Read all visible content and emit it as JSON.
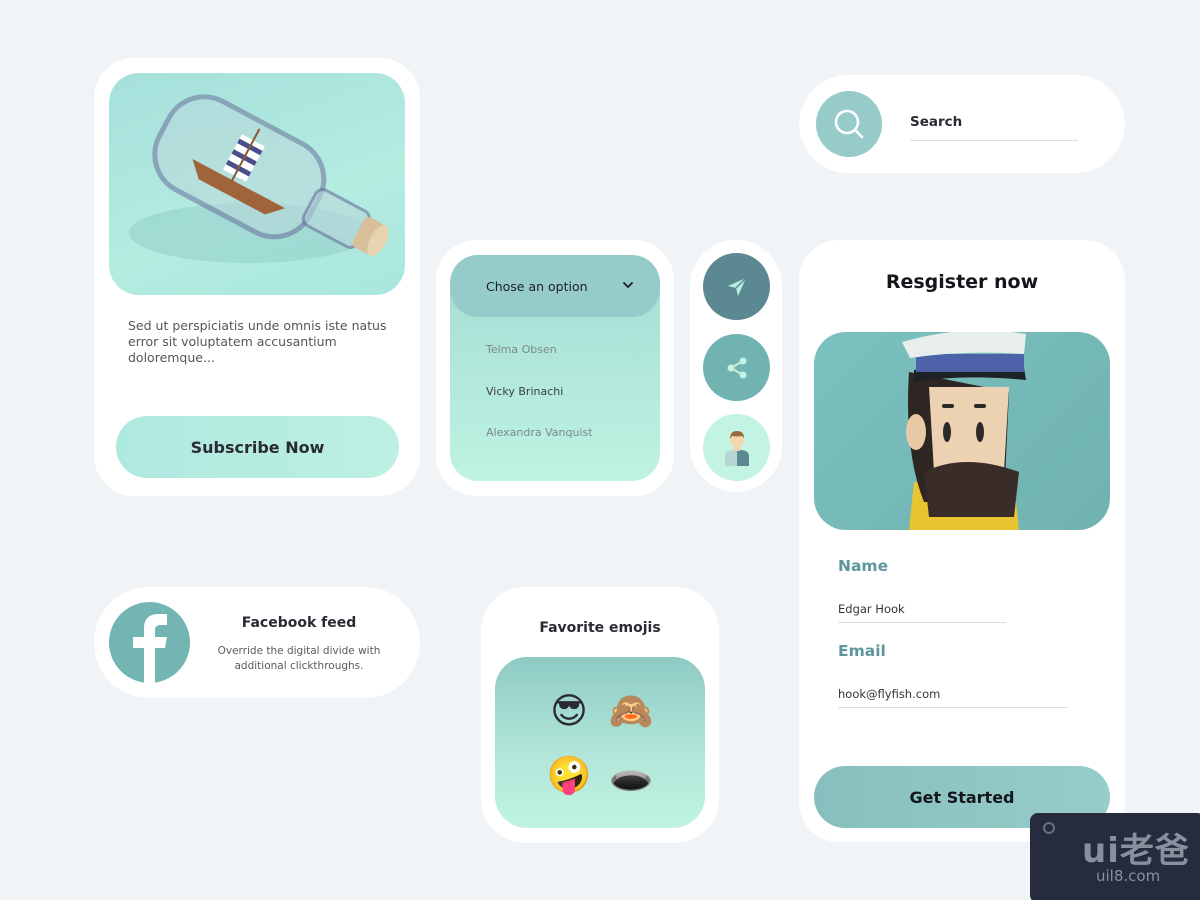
{
  "bottle_card": {
    "image_alt": "Ship in a bottle illustration",
    "description": "Sed ut perspiciatis unde omnis iste natus error sit voluptatem accusantium doloremque...",
    "subscribe_label": "Subscribe Now"
  },
  "dropdown": {
    "label": "Chose an option",
    "options": [
      {
        "label": "Telma Obsen",
        "active": false
      },
      {
        "label": "Vicky Brinachi",
        "active": true
      },
      {
        "label": "Alexandra Vanquist",
        "active": false
      }
    ]
  },
  "icon_buttons": [
    {
      "icon": "send-icon"
    },
    {
      "icon": "share-icon"
    },
    {
      "icon": "user-profile-icon"
    }
  ],
  "search": {
    "placeholder": "Search",
    "value": ""
  },
  "register": {
    "title": "Resgister now",
    "image_alt": "Sea captain character",
    "name_label": "Name",
    "name_value": "Edgar Hook",
    "email_label": "Email",
    "email_value": "hook@flyfish.com",
    "submit_label": "Get Started"
  },
  "facebook": {
    "title": "Facebook feed",
    "description": "Override the digital divide with additional clickthroughs."
  },
  "emojis": {
    "title": "Favorite emojis",
    "items": [
      "😎",
      "🙈",
      "🤪",
      "🕳️"
    ]
  },
  "watermark": {
    "logo": "ui老爸",
    "url": "uil8.com"
  },
  "colors": {
    "background": "#f0f4f7",
    "accent_teal": "#96cbc9",
    "accent_mint": "#bdf0e2",
    "dark_teal": "#5c8892",
    "label_teal": "#5e979b"
  }
}
